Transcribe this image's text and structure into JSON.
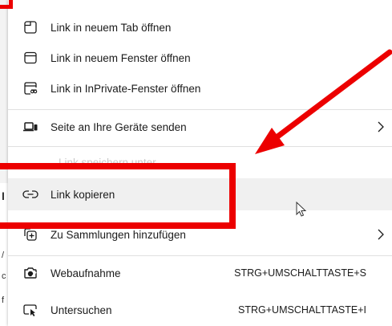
{
  "menu": {
    "items": [
      {
        "label": "Link in neuem Tab öffnen",
        "icon": "tab-icon"
      },
      {
        "label": "Link in neuem Fenster öffnen",
        "icon": "window-icon"
      },
      {
        "label": "Link in InPrivate-Fenster öffnen",
        "icon": "inprivate-window-icon"
      },
      {
        "label": "Seite an Ihre Geräte senden",
        "icon": "send-to-devices-icon",
        "submenu": true
      },
      {
        "label": "Link kopieren",
        "icon": "link-icon",
        "highlighted": true
      },
      {
        "label": "Zu Sammlungen hinzufügen",
        "icon": "collections-icon",
        "submenu": true
      },
      {
        "label": "Webaufnahme",
        "icon": "web-capture-icon",
        "shortcut": "STRG+UMSCHALTTASTE+S"
      },
      {
        "label": "Untersuchen",
        "icon": "inspect-icon",
        "shortcut": "STRG+UMSCHALTTASTE+I"
      }
    ]
  },
  "annotations": {
    "highlight_color": "#ec0000"
  },
  "colors": {
    "menu_background": "#ffffff",
    "hover_background": "#f0f0f0",
    "text": "#1b1b1b"
  }
}
